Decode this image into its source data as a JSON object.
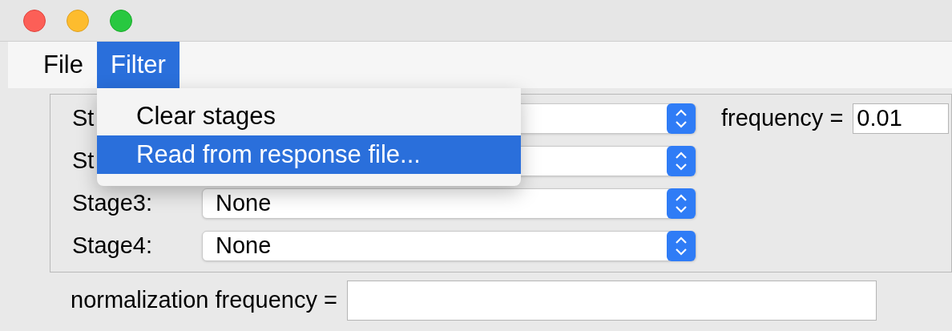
{
  "menu_bar": [
    {
      "label": "File",
      "selected": false
    },
    {
      "label": "Filter",
      "selected": true
    }
  ],
  "open_menu": {
    "items": [
      {
        "label": "Clear stages",
        "selected": false
      },
      {
        "label": "Read from response file...",
        "selected": true
      }
    ]
  },
  "stages": [
    {
      "label": "St"
    },
    {
      "label": "St"
    },
    {
      "label": "Stage3:",
      "value": "None"
    },
    {
      "label": "Stage4:",
      "value": "None"
    }
  ],
  "frequency": {
    "label": "frequency =",
    "value": "0.01"
  },
  "normalization": {
    "label": "normalization frequency ="
  }
}
